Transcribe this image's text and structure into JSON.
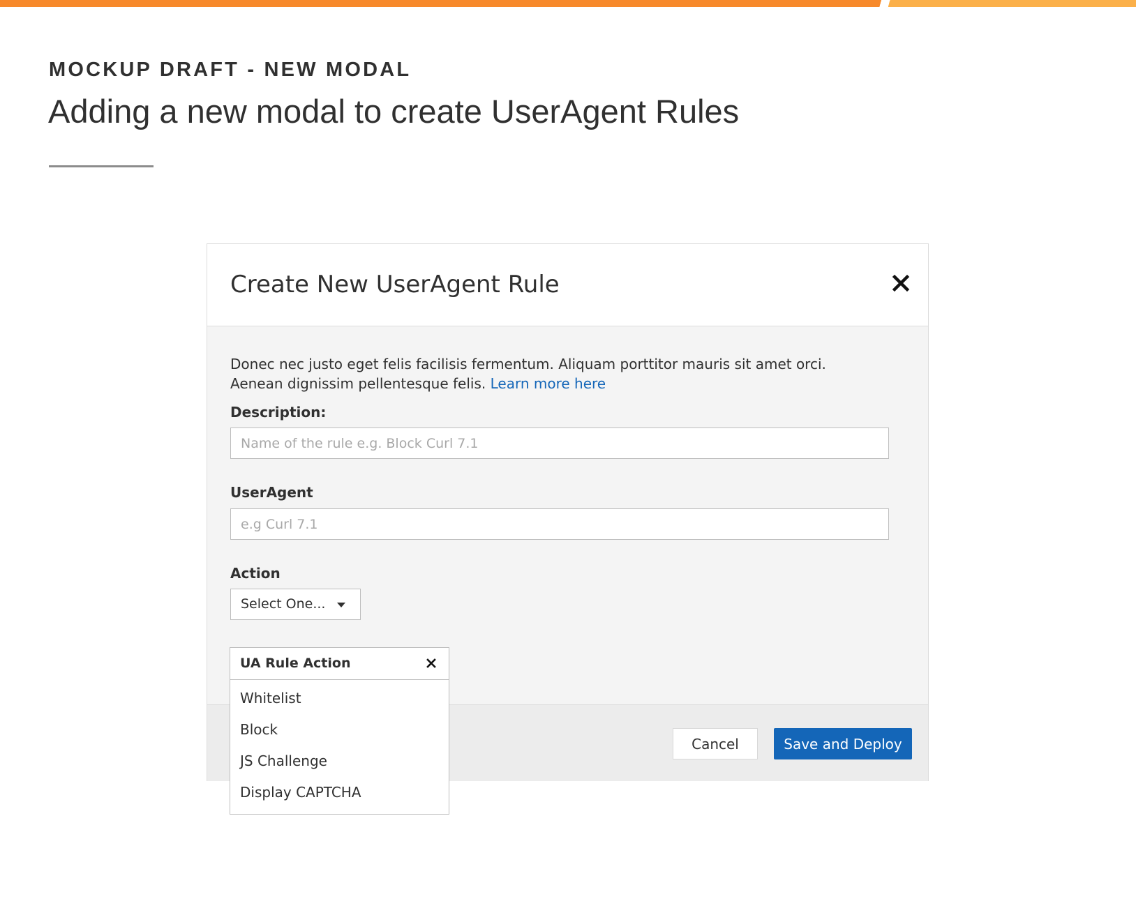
{
  "header": {
    "eyebrow": "MOCKUP DRAFT - NEW MODAL",
    "headline": "Adding a new modal to create UserAgent Rules"
  },
  "modal": {
    "title": "Create New UserAgent Rule",
    "close_icon": "close-icon",
    "intro_text": "Donec nec justo eget felis facilisis fermentum. Aliquam porttitor mauris sit amet orci. Aenean dignissim pellentesque felis.",
    "learn_more": "Learn more here",
    "description": {
      "label": "Description:",
      "value": "",
      "placeholder": "Name of the rule e.g. Block Curl 7.1"
    },
    "useragent": {
      "label": "UserAgent",
      "value": "",
      "placeholder": "e.g Curl 7.1"
    },
    "action": {
      "label": "Action",
      "selected": "Select One...",
      "caret_icon": "caret-down-icon"
    },
    "footer": {
      "cancel_label": "Cancel",
      "save_label": "Save and Deploy"
    }
  },
  "dropdown": {
    "title": "UA Rule Action",
    "close_icon": "close-icon",
    "options": [
      "Whitelist",
      "Block",
      "JS Challenge",
      "Display CAPTCHA"
    ]
  },
  "colors": {
    "accent_orange": "#f7892b",
    "accent_orange_light": "#fbb04a",
    "primary_blue": "#1466b8",
    "text": "#303030"
  }
}
